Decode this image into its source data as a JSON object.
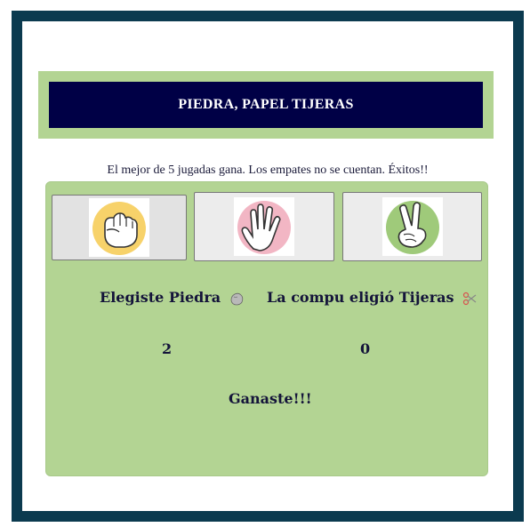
{
  "header": {
    "title": "PIEDRA, PAPEL TIJERAS"
  },
  "subtitle": "El mejor de 5 jugadas gana. Los empates no se cuentan. Éxitos!!",
  "choices": [
    {
      "name": "rock",
      "icon": "rock-hand-icon",
      "bg_color": "#f7d26a"
    },
    {
      "name": "paper",
      "icon": "paper-hand-icon",
      "bg_color": "#f2b6c4"
    },
    {
      "name": "scissors",
      "icon": "scissors-hand-icon",
      "bg_color": "#9fca7a"
    }
  ],
  "result": {
    "user_choice": "Elegiste Piedra",
    "user_icon": "rock-icon",
    "computer_choice": "La compu eligió Tijeras",
    "computer_icon": "scissors-icon",
    "user_score": "2",
    "computer_score": "0",
    "message": "Ganaste!!!"
  },
  "colors": {
    "frame": "#0b3a4f",
    "header_band": "#b3d493",
    "header_bar": "#000046",
    "panel": "#b3d493",
    "text": "#14143a"
  }
}
